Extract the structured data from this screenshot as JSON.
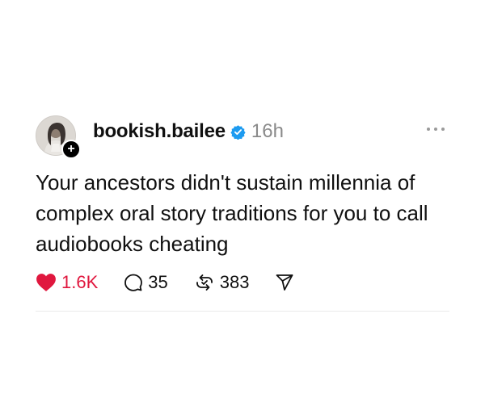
{
  "post": {
    "username": "bookish.bailee",
    "time": "16h",
    "text": "Your ancestors didn't sustain millennia of complex oral story traditions for you to call audiobooks cheating",
    "follow_symbol": "+",
    "verified_icon": "verified-badge-icon",
    "more_icon": "more-options-icon"
  },
  "actions": {
    "likes": "1.6K",
    "replies": "35",
    "reposts": "383"
  },
  "colors": {
    "like": "#e0173e",
    "verified": "#1d9bf0",
    "muted": "#8a8a8a"
  }
}
